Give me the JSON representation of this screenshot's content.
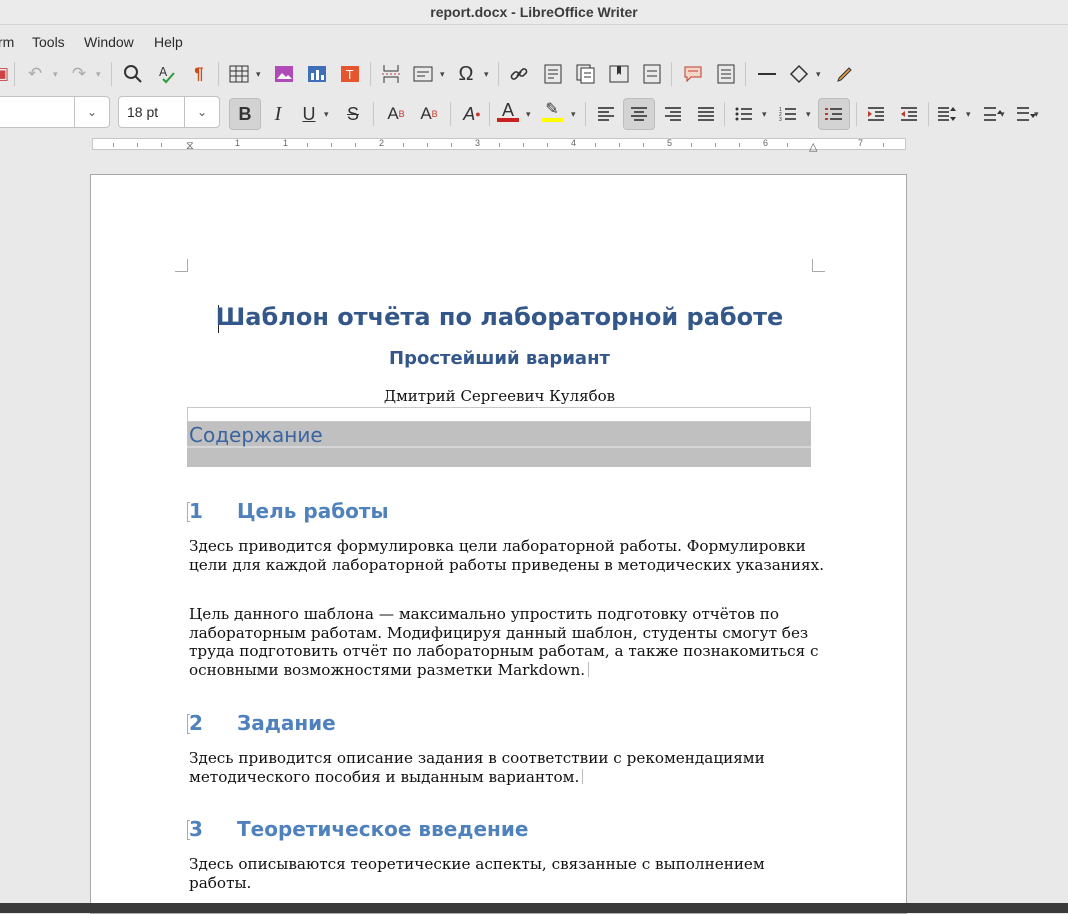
{
  "window": {
    "title": "report.docx - LibreOffice Writer"
  },
  "menu": {
    "items": [
      "rm",
      "Tools",
      "Window",
      "Help"
    ]
  },
  "format": {
    "paragraph_style": "",
    "font_size": "18 pt"
  },
  "toolbar_icons": {
    "row1": [
      "undo-icon",
      "redo-icon",
      "find-replace-icon",
      "spellcheck-icon",
      "formatting-marks-icon",
      "insert-table-icon",
      "insert-image-icon",
      "insert-chart-icon",
      "insert-textbox-icon",
      "page-break-icon",
      "insert-field-icon",
      "special-character-icon",
      "hyperlink-icon",
      "footnote-icon",
      "endnote-icon",
      "bookmark-icon",
      "cross-reference-icon",
      "comment-icon",
      "track-changes-icon",
      "insert-line-icon",
      "basic-shapes-icon",
      "draw-functions-icon"
    ],
    "row2": [
      "bold-icon",
      "italic-icon",
      "underline-icon",
      "strikethrough-icon",
      "superscript-icon",
      "subscript-icon",
      "clear-formatting-icon",
      "font-color-icon",
      "highlight-icon",
      "align-left-icon",
      "align-center-icon",
      "align-right-icon",
      "justify-icon",
      "unordered-list-icon",
      "ordered-list-icon",
      "outline-list-icon",
      "increase-indent-icon",
      "decrease-indent-icon",
      "line-spacing-icon",
      "paragraph-spacing-above-icon",
      "paragraph-spacing-below-icon"
    ]
  },
  "ruler": {
    "numbers": [
      "1",
      "1",
      "2",
      "3",
      "4",
      "5",
      "6",
      "7"
    ]
  },
  "document": {
    "title": "Шаблон отчёта по лабораторной работе",
    "subtitle": "Простейший вариант",
    "author": "Дмитрий Сергеевич Кулябов",
    "toc_title": "Содержание",
    "sections": [
      {
        "number": "1",
        "title": "Цель работы",
        "paragraphs": [
          "Здесь приводится формулировка цели лабораторной работы. Формулировки цели для каждой лабораторной работы приведены в методических указаниях.",
          "Цель данного шаблона — максимально упростить подготовку отчётов по лабораторным работам. Модифицируя данный шаблон, студенты смогут без труда подготовить отчёт по лабораторным работам, а также познакомиться с основными возможностями разметки Markdown."
        ]
      },
      {
        "number": "2",
        "title": "Задание",
        "paragraphs": [
          "Здесь приводится описание задания в соответствии с рекомендациями методического пособия и выданным вариантом."
        ]
      },
      {
        "number": "3",
        "title": "Теоретическое введение",
        "paragraphs": [
          "Здесь описываются теоретические аспекты, связанные с выполнением работы."
        ]
      }
    ]
  },
  "colors": {
    "heading": "#4f81bd",
    "title": "#34578a",
    "toc_shade": "#c0c0c0"
  }
}
